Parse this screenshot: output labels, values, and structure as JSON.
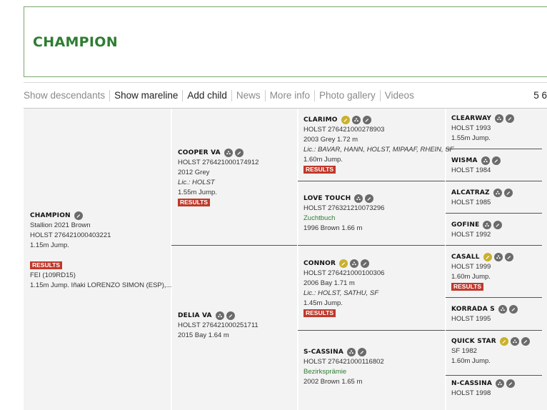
{
  "header": {
    "title": "CHAMPION"
  },
  "toolbar": {
    "items": [
      {
        "label": "Show descendants",
        "style": "light"
      },
      {
        "label": "Show mareline",
        "style": "dark"
      },
      {
        "label": "Add child",
        "style": "dark"
      },
      {
        "label": "News",
        "style": "light"
      },
      {
        "label": "More info",
        "style": "light"
      },
      {
        "label": "Photo gallery",
        "style": "light"
      },
      {
        "label": "Videos",
        "style": "light"
      }
    ],
    "pager": "5 6"
  },
  "results_label": "RESULTS",
  "horses": {
    "champion": {
      "name": "CHAMPION",
      "line1": "Stallion 2021 Brown",
      "line2": "HOLST 276421000403221",
      "line3": "1.15m Jump.",
      "result_event": "FEI (109RD15)",
      "result_detail": "1.15m Jump. Iñaki LORENZO SIMON (ESP),..."
    },
    "cooper": {
      "name": "COOPER VA",
      "reg": "HOLST 276421000174912",
      "info": "2012 Grey",
      "lic": "Lic.: HOLST",
      "jump": "1.55m Jump."
    },
    "delia": {
      "name": "DELIA VA",
      "reg": "HOLST 276421000251711",
      "info": "2015 Bay 1.64 m"
    },
    "clarimo": {
      "name": "CLARIMO",
      "reg": "HOLST 276421000278903",
      "info": "2003 Grey 1.72 m",
      "lic": "Lic.: BAVAR, HANN, HOLST, MIPAAF, RHEIN, SF",
      "jump": "1.60m Jump."
    },
    "lovetouch": {
      "name": "LOVE TOUCH",
      "reg": "HOLST 276321210073296",
      "note": "Zuchtbuch",
      "info": "1996 Brown 1.66 m"
    },
    "connor": {
      "name": "CONNOR",
      "reg": "HOLST 276421000100306",
      "info": "2006 Bay 1.71 m",
      "lic": "Lic.: HOLST, SATHU, SF",
      "jump": "1.45m Jump."
    },
    "scassina": {
      "name": "S-CASSINA",
      "reg": "HOLST 276421000116802",
      "note": "Bezirksprämie",
      "info": "2002 Brown 1.65 m"
    },
    "clearway": {
      "name": "CLEARWAY",
      "reg": "HOLST 1993",
      "jump": "1.55m Jump."
    },
    "wisma": {
      "name": "WISMA",
      "reg": "HOLST 1984"
    },
    "alcatraz": {
      "name": "ALCATRAZ",
      "reg": "HOLST 1985"
    },
    "gofine": {
      "name": "GOFINE",
      "reg": "HOLST 1992"
    },
    "casall": {
      "name": "CASALL",
      "reg": "HOLST 1999",
      "jump": "1.60m Jump."
    },
    "korradas": {
      "name": "KORRADA S",
      "reg": "HOLST 1995"
    },
    "quickstar": {
      "name": "QUICK STAR",
      "reg": "SF 1982",
      "jump": "1.60m Jump."
    },
    "ncassina": {
      "name": "N-CASSINA",
      "reg": "HOLST 1998"
    }
  },
  "colors": {
    "brand_green": "#2e7d32",
    "results_red": "#c0392b",
    "icon_gray": "#6b6b6b",
    "icon_gold": "#c9b12b"
  }
}
